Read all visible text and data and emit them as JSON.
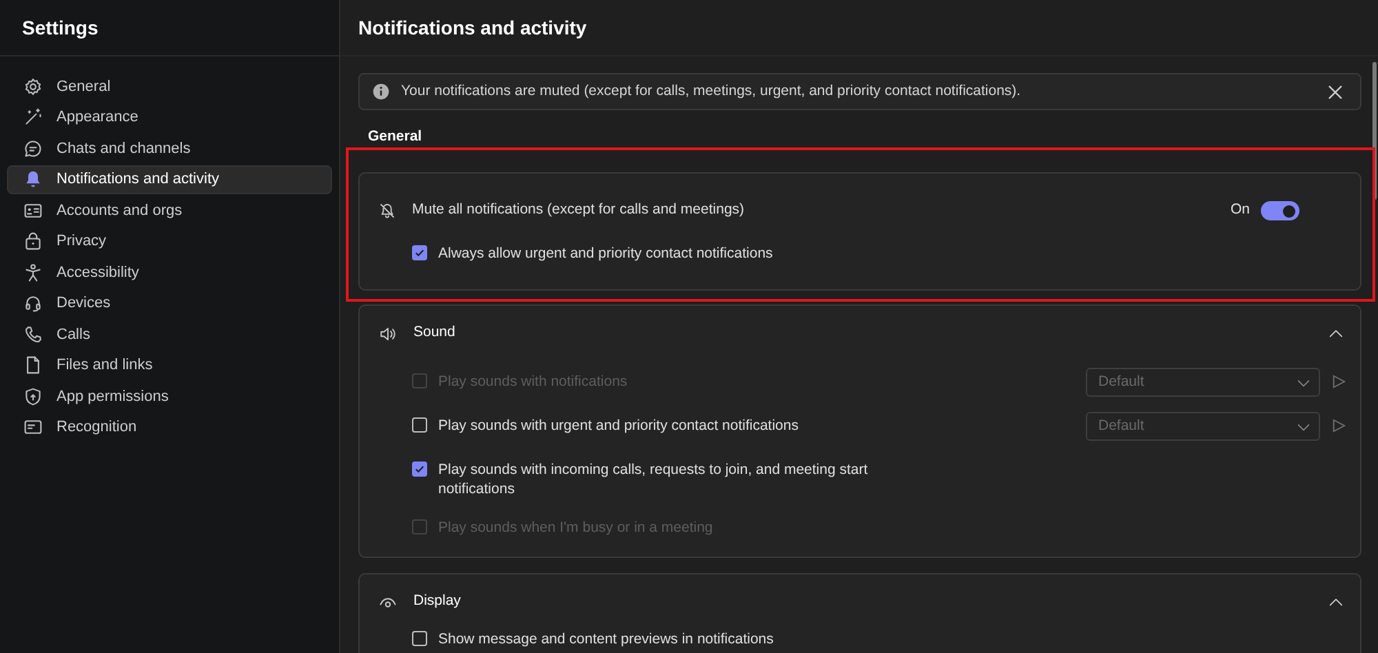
{
  "sidebar": {
    "title": "Settings",
    "items": [
      {
        "label": "General",
        "selected": false
      },
      {
        "label": "Appearance",
        "selected": false
      },
      {
        "label": "Chats and channels",
        "selected": false
      },
      {
        "label": "Notifications and activity",
        "selected": true
      },
      {
        "label": "Accounts and orgs",
        "selected": false
      },
      {
        "label": "Privacy",
        "selected": false
      },
      {
        "label": "Accessibility",
        "selected": false
      },
      {
        "label": "Devices",
        "selected": false
      },
      {
        "label": "Calls",
        "selected": false
      },
      {
        "label": "Files and links",
        "selected": false
      },
      {
        "label": "App permissions",
        "selected": false
      },
      {
        "label": "Recognition",
        "selected": false
      }
    ]
  },
  "main": {
    "title": "Notifications and activity",
    "banner": {
      "text": "Your notifications are muted (except for calls, meetings, urgent, and priority contact notifications)."
    },
    "general": {
      "heading": "General",
      "highlighted": true,
      "toggle": {
        "label": "Mute all notifications (except for calls and meetings)",
        "state_label": "On",
        "on": true
      },
      "checkbox": {
        "label": "Always allow urgent and priority contact notifications",
        "checked": true,
        "disabled": false
      }
    },
    "sections": [
      {
        "title": "Sound",
        "expanded": true,
        "items": [
          {
            "label": "Play sounds with notifications",
            "checked": false,
            "disabled": true,
            "dropdown": "Default"
          },
          {
            "label": "Play sounds with urgent and priority contact notifications",
            "checked": false,
            "disabled": false,
            "dropdown": "Default"
          },
          {
            "label": "Play sounds with incoming calls, requests to join, and meeting start notifications",
            "checked": true,
            "disabled": false
          },
          {
            "label": "Play sounds when I'm busy or in a meeting",
            "checked": false,
            "disabled": true
          }
        ]
      },
      {
        "title": "Display",
        "expanded": true,
        "items": [
          {
            "label": "Show message and content previews in notifications",
            "checked": false,
            "disabled": false
          }
        ]
      }
    ]
  }
}
